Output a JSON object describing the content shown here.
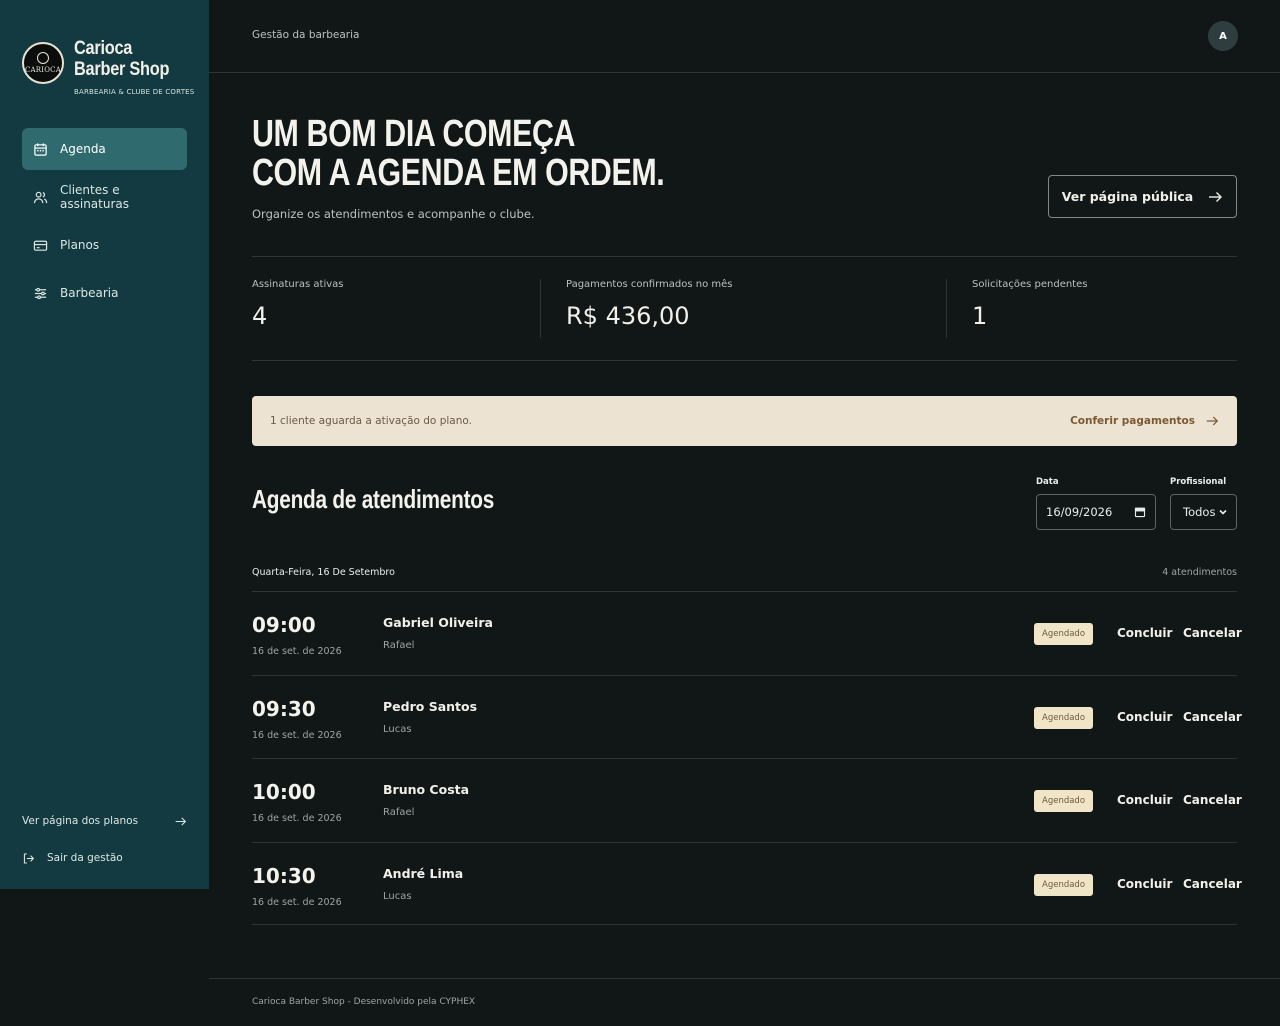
{
  "brand": {
    "name": "Carioca Barber Shop",
    "subtitle": "BARBEARIA & CLUBE DE CORTES",
    "logo_text": "CARIOCA"
  },
  "sidebar": {
    "items": [
      {
        "label": "Agenda",
        "icon": "calendar-icon",
        "active": true
      },
      {
        "label": "Clientes e assinaturas",
        "icon": "users-icon",
        "active": false
      },
      {
        "label": "Planos",
        "icon": "credit-card-icon",
        "active": false
      },
      {
        "label": "Barbearia",
        "icon": "sliders-icon",
        "active": false
      }
    ],
    "plans_link": "Ver página dos planos",
    "logout": "Sair da gestão"
  },
  "header": {
    "title": "Gestão da barbearia",
    "avatar_initial": "A"
  },
  "hero": {
    "title": "UM BOM DIA COMEÇA\nCOM A AGENDA EM ORDEM.",
    "subtitle": "Organize os atendimentos e acompanhe o clube.",
    "public_button": "Ver página pública"
  },
  "stats": [
    {
      "label": "Assinaturas ativas",
      "value": "4"
    },
    {
      "label": "Pagamentos confirmados no mês",
      "value": "R$ 436,00"
    },
    {
      "label": "Solicitações pendentes",
      "value": "1"
    }
  ],
  "notice": {
    "text": "1 cliente aguarda a ativação do plano.",
    "link": "Conferir pagamentos"
  },
  "schedule": {
    "title": "Agenda de atendimentos",
    "date_label": "Data",
    "date_value": "16/09/2026",
    "professional_label": "Profissional",
    "professional_value": "Todos",
    "day_label": "Quarta-Feira, 16 De Setembro",
    "count_label": "4 atendimentos",
    "appointments": [
      {
        "time": "09:00",
        "date": "16 de set. de 2026",
        "client": "Gabriel Oliveira",
        "professional": "Rafael",
        "status": "Agendado",
        "conclude": "Concluir",
        "cancel": "Cancelar"
      },
      {
        "time": "09:30",
        "date": "16 de set. de 2026",
        "client": "Pedro Santos",
        "professional": "Lucas",
        "status": "Agendado",
        "conclude": "Concluir",
        "cancel": "Cancelar"
      },
      {
        "time": "10:00",
        "date": "16 de set. de 2026",
        "client": "Bruno Costa",
        "professional": "Rafael",
        "status": "Agendado",
        "conclude": "Concluir",
        "cancel": "Cancelar"
      },
      {
        "time": "10:30",
        "date": "16 de set. de 2026",
        "client": "André Lima",
        "professional": "Lucas",
        "status": "Agendado",
        "conclude": "Concluir",
        "cancel": "Cancelar"
      }
    ]
  },
  "footer": {
    "text": "Carioca Barber Shop - Desenvolvido pela CYPHEX"
  },
  "colors": {
    "background": "#111717",
    "sidebar": "#133a40",
    "sidebar_active": "#2f6a6f",
    "notice_bg": "#ece3d2",
    "badge_bg": "#f1e5c8"
  }
}
